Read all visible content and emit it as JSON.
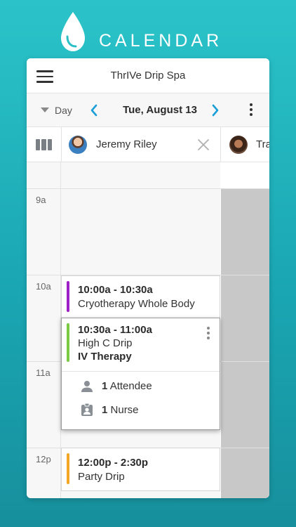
{
  "brand": {
    "title": "CALENDAR",
    "icon": "water-drop-icon"
  },
  "app": {
    "title": "ThrIVe Drip Spa",
    "menu_icon": "hamburger-menu-icon"
  },
  "datebar": {
    "view": "Day",
    "date": "Tue, August 13"
  },
  "staff": [
    {
      "name": "Jeremy Riley"
    },
    {
      "name": "Tra"
    }
  ],
  "hours": [
    "9a",
    "10a",
    "11a",
    "12p"
  ],
  "events": [
    {
      "time": "10:00a - 10:30a",
      "name": "Cryotherapy Whole Body",
      "color": "#a020c8"
    },
    {
      "time": "10:30a - 11:00a",
      "name": "High C Drip",
      "service": "IV Therapy",
      "color": "#7ac943",
      "attendees_count": "1",
      "attendees_label": "Attendee",
      "nurse_count": "1",
      "nurse_label": "Nurse"
    },
    {
      "time": "12:00p - 2:30p",
      "name": "Party Drip",
      "color": "#f5a623"
    }
  ],
  "colors": {
    "accent": "#1a9ed8",
    "bg_top": "#2bc3c9",
    "bg_bottom": "#178f9c"
  }
}
